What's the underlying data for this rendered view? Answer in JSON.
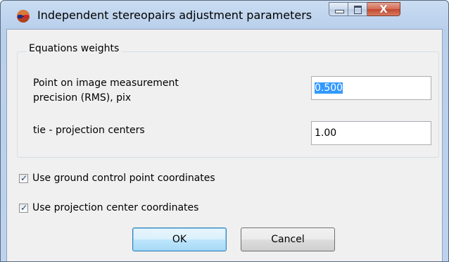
{
  "window": {
    "title": "Independent stereopairs adjustment parameters",
    "close_label": "X"
  },
  "group": {
    "title": "Equations weights"
  },
  "fields": [
    {
      "label_line1": "Point on image measurement",
      "label_line2": "precision (RMS), pix",
      "value": "0.500"
    },
    {
      "label": "tie - projection centers",
      "value": "1.00"
    }
  ],
  "checkboxes": [
    {
      "label": "Use ground control point coordinates",
      "checked": true
    },
    {
      "label": "Use projection center coordinates",
      "checked": true
    }
  ],
  "buttons": {
    "ok": "OK",
    "cancel": "Cancel"
  },
  "colors": {
    "titlebar": "#c9dcf1",
    "selection": "#3399ff",
    "close_button": "#c2462d"
  }
}
